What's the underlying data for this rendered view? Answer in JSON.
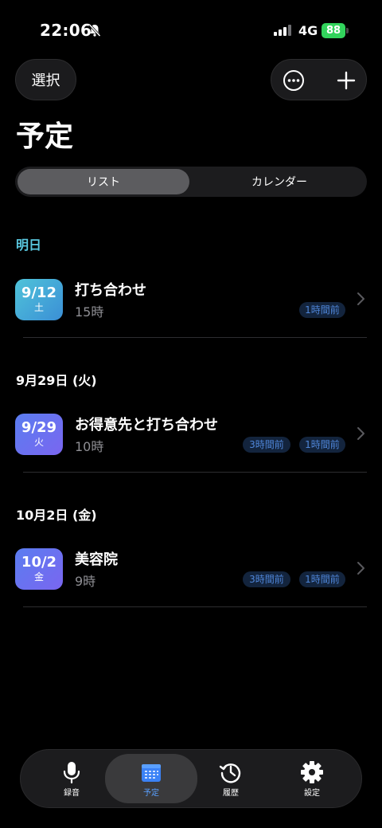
{
  "status_bar": {
    "time": "22:06",
    "network": "4G",
    "battery": "88"
  },
  "toolbar": {
    "select_label": "選択"
  },
  "page_title": "予定",
  "segment": {
    "list_label": "リスト",
    "calendar_label": "カレンダー"
  },
  "sections": [
    {
      "header": "明日",
      "events": [
        {
          "date": "9/12",
          "weekday": "土",
          "title": "打ち合わせ",
          "time": "15時",
          "reminders": [
            "1時間前"
          ]
        }
      ]
    },
    {
      "header": "9月29日 (火)",
      "events": [
        {
          "date": "9/29",
          "weekday": "火",
          "title": "お得意先と打ち合わせ",
          "time": "10時",
          "reminders": [
            "3時間前",
            "1時間前"
          ]
        }
      ]
    },
    {
      "header": "10月2日 (金)",
      "events": [
        {
          "date": "10/2",
          "weekday": "金",
          "title": "美容院",
          "time": "9時",
          "reminders": [
            "3時間前",
            "1時間前"
          ]
        }
      ]
    }
  ],
  "tab_bar": {
    "record": "録音",
    "schedule": "予定",
    "history": "履歴",
    "settings": "設定"
  },
  "colors": {
    "accent_section": "#5ac8e0",
    "tab_active": "#5aa0ff",
    "badge_tomorrow": [
      "#4fc3d9",
      "#3b8fd6"
    ],
    "badge_future": [
      "#5a7df0",
      "#7a66f0"
    ],
    "chip_text": "#4f86d9"
  }
}
